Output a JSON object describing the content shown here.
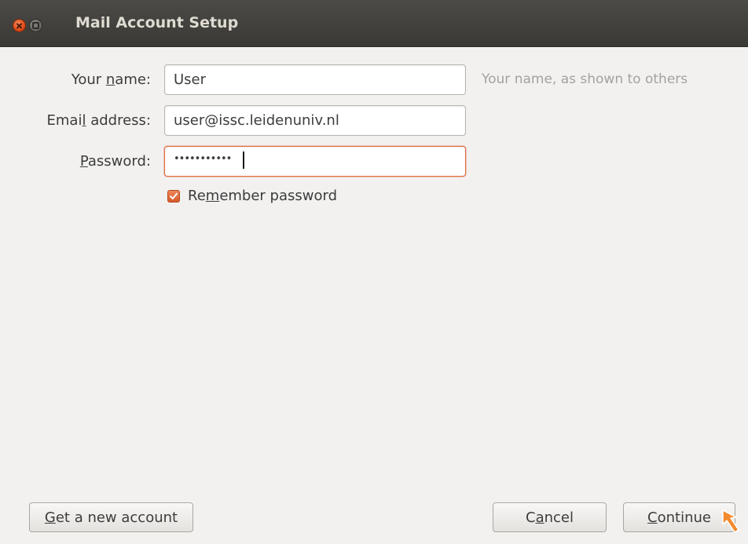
{
  "window": {
    "title": "Mail Account Setup"
  },
  "form": {
    "name_label": "Your name:",
    "name_value": "User",
    "name_hint": "Your name, as shown to others",
    "email_label": "Email address:",
    "email_value": "user@issc.leidenuniv.nl",
    "password_label": "Password:",
    "password_mask": "•••••••••••",
    "remember_label": "Remember password",
    "remember_checked": true
  },
  "buttons": {
    "get_new_account": "Get a new account",
    "cancel": "Cancel",
    "continue": "Continue"
  },
  "colors": {
    "accent": "#e36d43",
    "titlebar": "#3c3b37"
  }
}
